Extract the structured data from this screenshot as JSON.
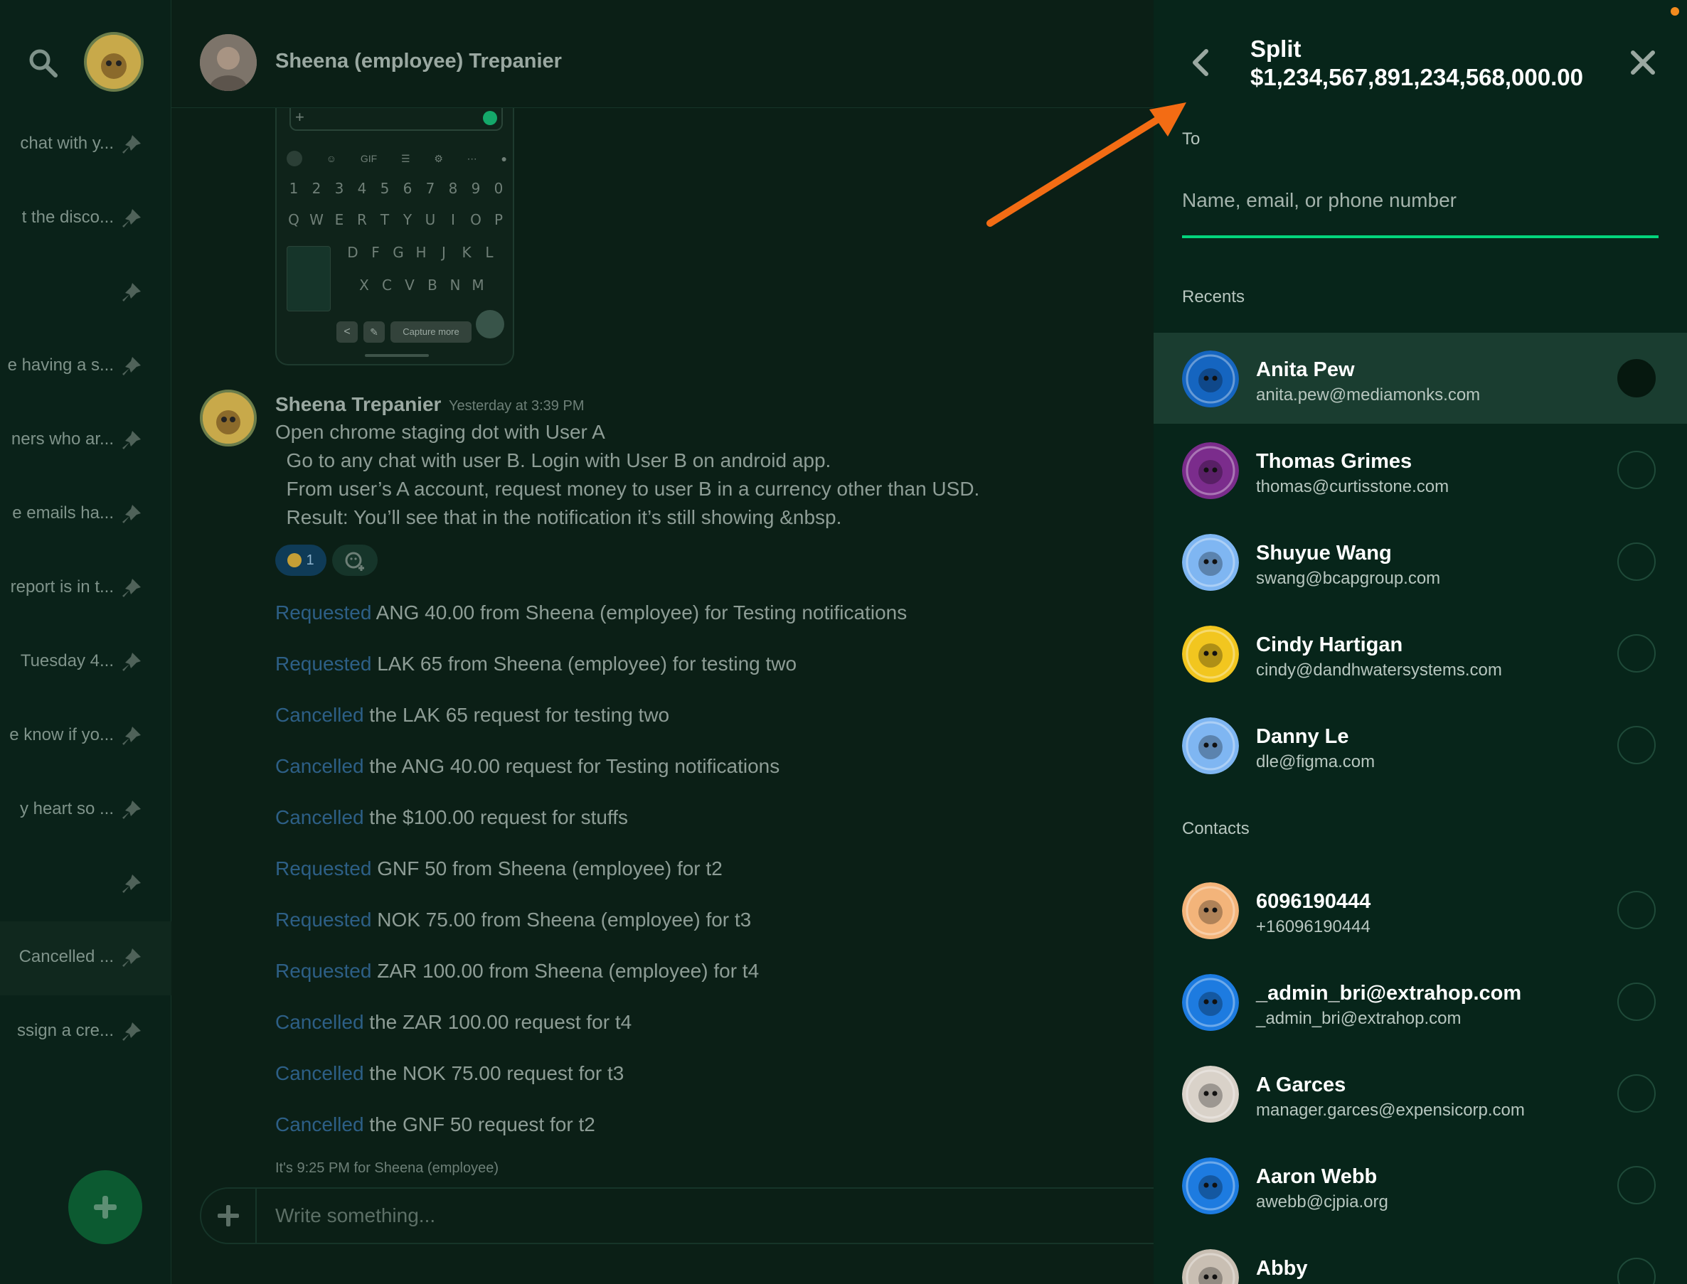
{
  "sidebar": {
    "items": [
      {
        "label": "chat with y...",
        "pinned": true
      },
      {
        "label": "t the disco...",
        "pinned": true
      },
      {
        "label": "",
        "pinned": true
      },
      {
        "label": "e having a s...",
        "pinned": true
      },
      {
        "label": "ners who ar...",
        "pinned": true
      },
      {
        "label": "e emails ha...",
        "pinned": true
      },
      {
        "label": "report is in t...",
        "pinned": true
      },
      {
        "label": "Tuesday 4...",
        "pinned": true
      },
      {
        "label": "e know if yo...",
        "pinned": true
      },
      {
        "label": "y heart so ...",
        "pinned": true
      },
      {
        "label": "",
        "pinned": true
      },
      {
        "label": "Cancelled ...",
        "pinned": true
      },
      {
        "label": "ssign a cre...",
        "pinned": true
      }
    ]
  },
  "chat": {
    "header_name": "Sheena (employee) Trepanier",
    "screenshot": {
      "kb_row_numbers": [
        "1",
        "2",
        "3",
        "4",
        "5",
        "6",
        "7",
        "8",
        "9",
        "0"
      ],
      "kb_row_q": [
        "Q",
        "W",
        "E",
        "R",
        "T",
        "Y",
        "U",
        "I",
        "O",
        "P"
      ],
      "kb_row_a": [
        "D",
        "F",
        "G",
        "H",
        "J",
        "K",
        "L"
      ],
      "kb_row_z": [
        "X",
        "C",
        "V",
        "B",
        "N",
        "M"
      ],
      "kb_toolbar_gif": "GIF",
      "capture_more": "Capture more"
    },
    "message": {
      "author": "Sheena Trepanier",
      "time": "Yesterday at 3:39 PM",
      "lines": [
        "Open chrome staging dot with User A",
        "  Go to any chat with user B. Login with User B on android app.",
        "  From user’s A account, request money to user B in a currency other than USD.",
        "  Result: You’ll see that in the notification it’s still showing &nbsp."
      ],
      "reaction_count": "1"
    },
    "system_messages": [
      {
        "action": "Requested",
        "text": " ANG 40.00 from Sheena (employee) for Testing notifications"
      },
      {
        "action": "Requested",
        "text": " LAK 65 from Sheena (employee) for testing two"
      },
      {
        "action": "Cancelled",
        "text": " the LAK 65 request for testing two"
      },
      {
        "action": "Cancelled",
        "text": " the ANG 40.00 request for Testing notifications"
      },
      {
        "action": "Cancelled",
        "text": " the $100.00 request for stuffs"
      },
      {
        "action": "Requested",
        "text": " GNF 50 from Sheena (employee) for t2"
      },
      {
        "action": "Requested",
        "text": " NOK 75.00 from Sheena (employee) for t3"
      },
      {
        "action": "Requested",
        "text": " ZAR 100.00 from Sheena (employee) for t4"
      },
      {
        "action": "Cancelled",
        "text": " the ZAR 100.00 request for t4"
      },
      {
        "action": "Cancelled",
        "text": " the NOK 75.00 request for t3"
      },
      {
        "action": "Cancelled",
        "text": " the GNF 50 request for t2"
      }
    ],
    "local_time_note": "It's 9:25 PM for Sheena (employee)",
    "composer_placeholder": "Write something..."
  },
  "panel": {
    "title": "Split",
    "amount": "$1,234,567,891,234,568,000.00",
    "to_label": "To",
    "search_placeholder": "Name, email, or phone number",
    "recents_label": "Recents",
    "contacts_label": "Contacts",
    "recents": [
      {
        "name": "Anita Pew",
        "email": "anita.pew@mediamonks.com",
        "selected": true,
        "avatar_color": "#1565c0"
      },
      {
        "name": "Thomas Grimes",
        "email": "thomas@curtisstone.com",
        "selected": false,
        "avatar_color": "#7b2c8c"
      },
      {
        "name": "Shuyue Wang",
        "email": "swang@bcapgroup.com",
        "selected": false,
        "avatar_color": "#7fb6f2"
      },
      {
        "name": "Cindy Hartigan",
        "email": "cindy@dandhwatersystems.com",
        "selected": false,
        "avatar_color": "#f2c61f"
      },
      {
        "name": "Danny Le",
        "email": "dle@figma.com",
        "selected": false,
        "avatar_color": "#7fb6f2"
      }
    ],
    "contacts": [
      {
        "name": "6096190444",
        "email": "+16096190444",
        "selected": false,
        "avatar_color": "#f3b47a"
      },
      {
        "name": "_admin_bri@extrahop.com",
        "email": "_admin_bri@extrahop.com",
        "selected": false,
        "avatar_color": "#1d7be0"
      },
      {
        "name": "A Garces",
        "email": "manager.garces@expensicorp.com",
        "selected": false,
        "avatar_color": "#d9d2c9"
      },
      {
        "name": "Aaron Webb",
        "email": "awebb@cjpia.org",
        "selected": false,
        "avatar_color": "#1d7be0"
      },
      {
        "name": "Abby",
        "email": "",
        "selected": false,
        "avatar_color": "#c9bfb3"
      }
    ]
  },
  "colors": {
    "accent_green": "#03d47c",
    "link_blue": "#2d5f86",
    "annotation_arrow": "#f36c14"
  }
}
